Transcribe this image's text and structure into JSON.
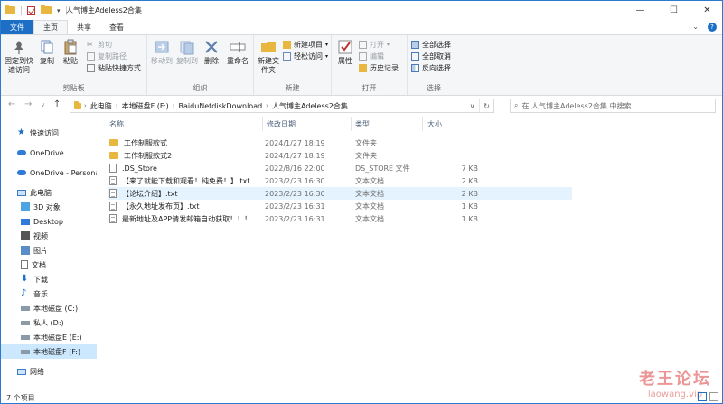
{
  "window": {
    "title": "人气博主Adeless2合集",
    "controls": [
      "—",
      "☐",
      "✕"
    ]
  },
  "tabs": [
    "文件",
    "主页",
    "共享",
    "查看"
  ],
  "ribbon": {
    "clipboard": {
      "pin": "固定到快速访问",
      "copy": "复制",
      "paste": "粘贴",
      "cut": "剪切",
      "copy_path": "复制路径",
      "paste_shortcut": "粘贴快捷方式",
      "label": "剪贴板"
    },
    "organize": {
      "move_to": "移动到",
      "copy_to": "复制到",
      "delete": "删除",
      "rename": "重命名",
      "label": "组织"
    },
    "new": {
      "new_folder": "新建文件夹",
      "new_item": "新建项目",
      "easy_access": "轻松访问",
      "label": "新建"
    },
    "open": {
      "properties": "属性",
      "open": "打开",
      "edit": "编辑",
      "history": "历史记录",
      "label": "打开"
    },
    "select": {
      "select_all": "全部选择",
      "select_none": "全部取消",
      "invert": "反向选择",
      "label": "选择"
    }
  },
  "address": {
    "crumbs": [
      "此电脑",
      "本地磁盘F (F:)",
      "BaiduNetdiskDownload",
      "人气博主Adeless2合集"
    ],
    "search_placeholder": "在 人气博主Adeless2合集 中搜索"
  },
  "nav": {
    "quick_access": "快速访问",
    "onedrive": "OneDrive",
    "onedrive_personal": "OneDrive - Persona",
    "this_pc": "此电脑",
    "objects3d": "3D 对象",
    "desktop": "Desktop",
    "videos": "视频",
    "pictures": "图片",
    "documents": "文档",
    "downloads": "下载",
    "music": "音乐",
    "drive_c": "本地磁盘 (C:)",
    "drive_d": "私人 (D:)",
    "drive_e": "本地磁盘E (E:)",
    "drive_f": "本地磁盘F (F:)",
    "network": "网络"
  },
  "columns": {
    "name": "名称",
    "date": "修改日期",
    "type": "类型",
    "size": "大小"
  },
  "files": [
    {
      "name": "工作制服款式",
      "date": "2024/1/27 18:19",
      "type": "文件夹",
      "size": "",
      "kind": "folder"
    },
    {
      "name": "工作制服款式2",
      "date": "2024/1/27 18:19",
      "type": "文件夹",
      "size": "",
      "kind": "folder"
    },
    {
      "name": ".DS_Store",
      "date": "2022/8/16 22:00",
      "type": "DS_STORE 文件",
      "size": "7 KB",
      "kind": "blank"
    },
    {
      "name": "【来了就能下载和观看！纯免费！】.txt",
      "date": "2023/2/23 16:30",
      "type": "文本文档",
      "size": "2 KB",
      "kind": "txt"
    },
    {
      "name": "【论坛介绍】.txt",
      "date": "2023/2/23 16:30",
      "type": "文本文档",
      "size": "2 KB",
      "kind": "txt"
    },
    {
      "name": "【永久地址发布页】.txt",
      "date": "2023/2/23 16:31",
      "type": "文本文档",
      "size": "1 KB",
      "kind": "txt"
    },
    {
      "name": "最新地址及APP请发邮箱自动获取！！！...",
      "date": "2023/2/23 16:31",
      "type": "文本文档",
      "size": "1 KB",
      "kind": "txt"
    }
  ],
  "status": {
    "count": "7 个项目"
  },
  "watermark": {
    "line1": "老王论坛",
    "line2": "laowang.vip"
  },
  "colors": {
    "accent": "#1d6fc6",
    "selected": "#cce8ff",
    "hover": "#e5f3ff",
    "folder": "#e8b740"
  }
}
